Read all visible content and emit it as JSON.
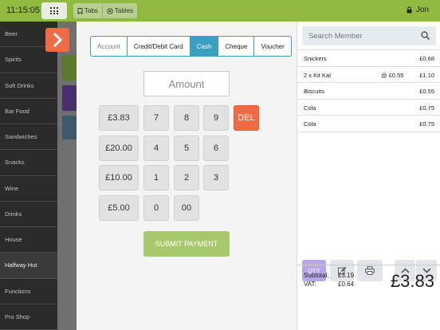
{
  "header": {
    "time": "11:15:05",
    "grid_icon": "grid-icon",
    "tabs_label": "Tabs",
    "tables_label": "Tables",
    "user": "Jon",
    "user_icon": "lock-icon",
    "accent": "#8fba3f"
  },
  "sidebar": {
    "items": [
      {
        "label": "Beer"
      },
      {
        "label": "Spirits"
      },
      {
        "label": "Soft Drinks"
      },
      {
        "label": "Bar Food"
      },
      {
        "label": "Sandwiches"
      },
      {
        "label": "Snacks"
      },
      {
        "label": "Wine"
      },
      {
        "label": "Drinks"
      },
      {
        "label": "House"
      },
      {
        "label": "Halfway Hut"
      },
      {
        "label": "Functions"
      },
      {
        "label": "Pro Shop"
      }
    ],
    "active_index": 9
  },
  "payment": {
    "methods": [
      "Account",
      "Credit/Debit Card",
      "Cash",
      "Cheque",
      "Voucher"
    ],
    "active_method": "Cash",
    "amount_placeholder": "Amount",
    "keys": {
      "q1": "£3.83",
      "q2": "£20.00",
      "q3": "£10.00",
      "q4": "£5.00",
      "k7": "7",
      "k8": "8",
      "k9": "9",
      "k4": "4",
      "k5": "5",
      "k6": "6",
      "k1": "1",
      "k2": "2",
      "k3": "3",
      "k0": "0",
      "k00": "00",
      "del": "DEL"
    },
    "submit_label": "SUBMIT PAYMENT",
    "accent_active": "#3a9fc3",
    "accent_del": "#f06b44",
    "accent_submit": "#a7c96c"
  },
  "order": {
    "search_placeholder": "Search Member",
    "lines": [
      {
        "name": "Snickers",
        "each": "",
        "price": "£0.68"
      },
      {
        "name": "2 x  Kit Kat",
        "each": "@ £0.55",
        "price": "£1.10"
      },
      {
        "name": "Biscuits",
        "each": "",
        "price": "£0.55"
      },
      {
        "name": "Cola",
        "each": "",
        "price": "£0.75"
      },
      {
        "name": "Cola",
        "each": "",
        "price": "£0.75"
      }
    ],
    "qty_label": "QTY",
    "subtotal_label": "Subtotal:",
    "subtotal": "£3.19",
    "vat_label": "VAT:",
    "vat": "£0.64",
    "total": "£3.83"
  }
}
